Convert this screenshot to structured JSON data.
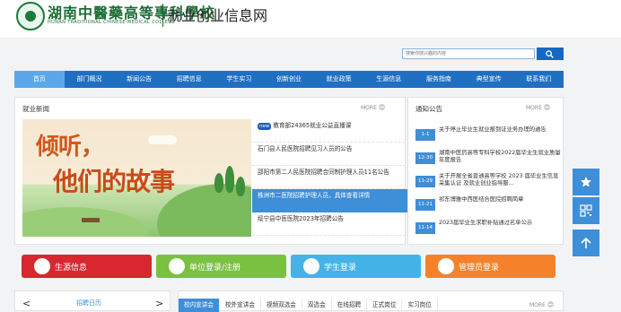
{
  "header": {
    "logo_cn": "湖南中醫藥高等專科學校",
    "logo_en": "HUNAN TRADITIONAL CHINESE MEDICAL COLLEGE",
    "site_title": "就业创业信息网"
  },
  "search": {
    "placeholder": "搜索你感兴趣的内容"
  },
  "nav": {
    "items": [
      "首页",
      "部门概况",
      "新闻公告",
      "招聘信息",
      "学生实习",
      "创新创业",
      "就业政策",
      "生源信息",
      "服务指南",
      "典型宣传",
      "联系我们"
    ],
    "active_index": 0
  },
  "news": {
    "title": "就业新闻",
    "more": "MORE",
    "banner_line1": "倾听，",
    "banner_line2": "他们的故事",
    "badge": "new",
    "items": [
      "教育部24365就业公益直播课",
      "石门县人民医院招聘见习人员的公告",
      "邵阳市第二人民医院招聘合同制护理人员11名公告",
      "株洲市二医院招聘护理人员，具体查看详情",
      "绥宁县中医医院2023年招聘公告"
    ],
    "active_index": 3
  },
  "notices": {
    "title": "通知公告",
    "more": "MORE",
    "items": [
      {
        "date": "1-1",
        "text": "关于停止毕业生就业报到证业务办理的通告"
      },
      {
        "date": "12-30",
        "text": "湖南中医药高等专科学校2022届毕业生就业质量年度报告"
      },
      {
        "date": "11-29",
        "text": "关于开展全省普通高等学校 2023 届毕业生信息采集认证 及就业创业指导服..."
      },
      {
        "date": "11-21",
        "text": "祁东博雅中西医结合医院招聘简章"
      },
      {
        "date": "11-14",
        "text": "2023届毕业生求职补贴通过名单公示"
      }
    ]
  },
  "quick_links": [
    {
      "label": "生源信息",
      "color": "#d9272f"
    },
    {
      "label": "单位登录/注册",
      "color": "#7ac142"
    },
    {
      "label": "学生登录",
      "color": "#43b3e8"
    },
    {
      "label": "管理员登录",
      "color": "#f5822a"
    }
  ],
  "calendar": {
    "title": "招聘日历",
    "prev": "<",
    "next": ">"
  },
  "recruit_tabs": {
    "items": [
      "校内宣讲会",
      "校外宣讲会",
      "视频双选会",
      "双选会",
      "在线招聘",
      "正式岗位",
      "实习岗位"
    ],
    "active_index": 0,
    "more": "MORE"
  },
  "side_float": [
    "star-icon",
    "qrcode-icon",
    "arrow-up-icon"
  ]
}
